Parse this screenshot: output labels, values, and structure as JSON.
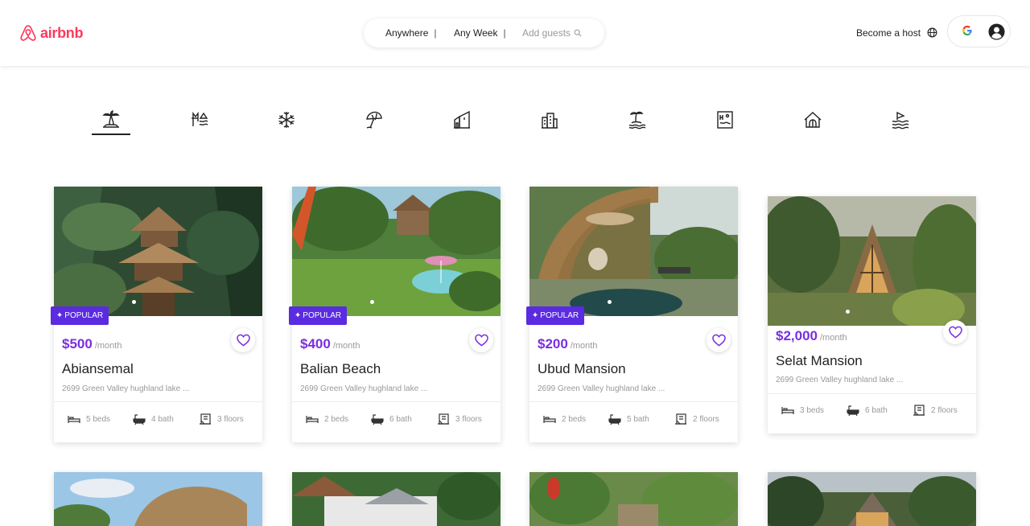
{
  "header": {
    "logo_text": "airbnb",
    "search": {
      "anywhere": "Anywhere",
      "week": "Any Week",
      "guests": "Add guests",
      "separator": "|"
    },
    "become_host": "Become a host",
    "google_letter": "G"
  },
  "categories": [
    {
      "icon": "palm-tree-icon",
      "selected": true
    },
    {
      "icon": "lake-icon"
    },
    {
      "icon": "snowflake-icon"
    },
    {
      "icon": "beach-umbrella-icon"
    },
    {
      "icon": "countryside-icon"
    },
    {
      "icon": "city-building-icon"
    },
    {
      "icon": "island-icon"
    },
    {
      "icon": "pool-icon"
    },
    {
      "icon": "cabin-icon"
    },
    {
      "icon": "waves-icon"
    }
  ],
  "listings": [
    {
      "badge": "POPULAR",
      "price": "$500",
      "per": "/month",
      "title": "Abiansemal",
      "address": "2699 Green Valley hughland lake ...",
      "beds": "5 beds",
      "bath": "4 bath",
      "floors": "3 floors"
    },
    {
      "badge": "POPULAR",
      "price": "$400",
      "per": "/month",
      "title": "Balian Beach",
      "address": "2699 Green Valley hughland lake ...",
      "beds": "2 beds",
      "bath": "6 bath",
      "floors": "3 floors"
    },
    {
      "badge": "POPULAR",
      "price": "$200",
      "per": "/month",
      "title": "Ubud Mansion",
      "address": "2699 Green Valley hughland lake ...",
      "beds": "2 beds",
      "bath": "5 bath",
      "floors": "2 floors"
    },
    {
      "badge": "",
      "price": "$2,000",
      "per": "/month",
      "title": "Selat Mansion",
      "address": "2699 Green Valley hughland lake ...",
      "beds": "3 beds",
      "bath": "6 bath",
      "floors": "2 floors"
    }
  ],
  "colors": {
    "brand": "#ff385c",
    "accent": "#7a2ee0",
    "badge": "#5a2be0"
  }
}
